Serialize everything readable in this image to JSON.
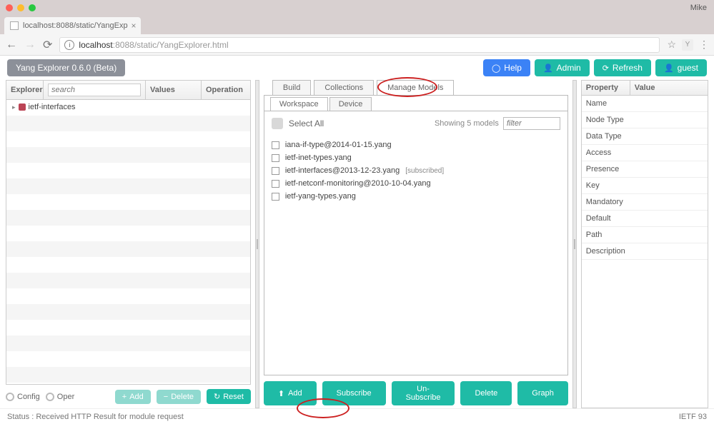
{
  "browser": {
    "user": "Mike",
    "tab_title": "localhost:8088/static/YangExp",
    "url_host": "localhost",
    "url_port": ":8088",
    "url_path": "/static/YangExplorer.html"
  },
  "app": {
    "title": "Yang Explorer 0.6.0 (Beta)",
    "buttons": {
      "help": "Help",
      "admin": "Admin",
      "refresh": "Refresh",
      "guest": "guest"
    }
  },
  "explorer": {
    "header_explorer": "Explorer",
    "header_values": "Values",
    "header_operation": "Operation",
    "search_placeholder": "search",
    "tree_item": "ietf-interfaces",
    "radio_config": "Config",
    "radio_oper": "Oper",
    "btn_add": "Add",
    "btn_delete": "Delete",
    "btn_reset": "Reset"
  },
  "tabs": {
    "build": "Build",
    "collections": "Collections",
    "manage_models": "Manage Models"
  },
  "subtabs": {
    "workspace": "Workspace",
    "device": "Device"
  },
  "models": {
    "select_all": "Select All",
    "showing": "Showing 5 models",
    "filter_placeholder": "filter",
    "items": [
      {
        "name": "iana-if-type@2014-01-15.yang",
        "sub": ""
      },
      {
        "name": "ietf-inet-types.yang",
        "sub": ""
      },
      {
        "name": "ietf-interfaces@2013-12-23.yang",
        "sub": "[subscribed]"
      },
      {
        "name": "ietf-netconf-monitoring@2010-10-04.yang",
        "sub": ""
      },
      {
        "name": "ietf-yang-types.yang",
        "sub": ""
      }
    ],
    "btn_add": "Add",
    "btn_subscribe": "Subscribe",
    "btn_unsubscribe": "Un-Subscribe",
    "btn_delete": "Delete",
    "btn_graph": "Graph"
  },
  "properties": {
    "header_property": "Property",
    "header_value": "Value",
    "rows": [
      "Name",
      "Node Type",
      "Data Type",
      "Access",
      "Presence",
      "Key",
      "Mandatory",
      "Default",
      "Path",
      "Description"
    ]
  },
  "status": {
    "left": "Status : Received HTTP Result for module request",
    "right": "IETF 93"
  }
}
